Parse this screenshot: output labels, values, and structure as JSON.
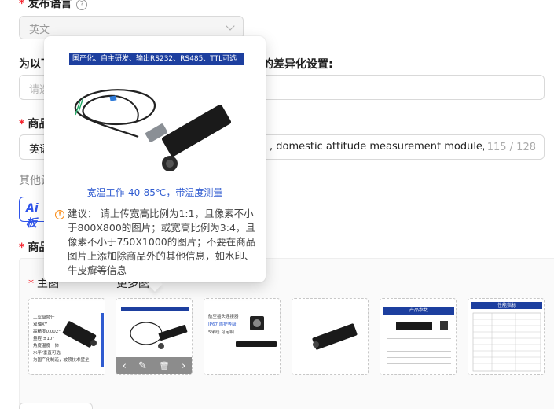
{
  "language_field": {
    "label": "发布语言",
    "help": "?",
    "value": "英文"
  },
  "diff_section": {
    "label_left": "为以下",
    "label_right": "的差异化设置:",
    "placeholder": "请选"
  },
  "title_field": {
    "label": "商品",
    "value_prefix": "英语",
    "value_suffix": ", domestic attitude measurement module, inc",
    "counter": "115 / 128"
  },
  "other_settings": {
    "label": "其他设",
    "ai_button": "Ai 板"
  },
  "images_section": {
    "label": "商品",
    "main_image_label": "主图",
    "more_images_label": "更多图"
  },
  "thumbnails": [
    {
      "name": "thumb-1",
      "banner": "",
      "lines": [
        "工业级倾什",
        "双轴XY",
        "高精度0.002°",
        "量程 ±10°",
        "角度温度一体",
        "水平/垂直可选",
        "为国产化制造，坡顶技术壁垒"
      ]
    },
    {
      "name": "thumb-2",
      "banner": "国产化 自主研发 输出RS232 RS485 TTL可选",
      "caption": "宽温工作-40-85℃，带温度测量"
    },
    {
      "name": "thumb-3",
      "lines": [
        "航空插头连接器",
        "IP67 防护等级",
        "5米线 可定制"
      ]
    },
    {
      "name": "thumb-4"
    },
    {
      "name": "thumb-5",
      "banner": "产品参数"
    },
    {
      "name": "thumb-6",
      "banner": "性能指标"
    }
  ],
  "popover": {
    "banner": "国产化、自主研发、输出RS232、RS485、TTL可选",
    "caption": "宽温工作-40-85℃，带温度测量",
    "tip": "建议： 请上传宽高比例为1:1，且像素不小于800X800的图片；或宽高比例为3:4，且像素不小于750X1000的图片；不要在商品图片上添加除商品外的其他信息，如水印、牛皮癣等信息",
    "warn_icon": "!"
  },
  "overlay_icons": {
    "prev": "‹",
    "edit": "✎",
    "delete": "🗑",
    "next": "›"
  },
  "colors": {
    "required": "#f5222d",
    "accent": "#2f54eb",
    "warning": "#fa8c16",
    "banner": "#1d3f9f"
  }
}
